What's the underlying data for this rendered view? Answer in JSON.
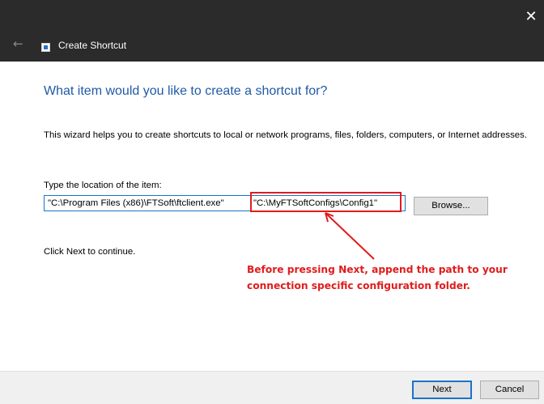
{
  "window": {
    "title": "Create Shortcut",
    "close_glyph": "✕",
    "back_glyph": "←",
    "back_icon": "back-arrow-icon",
    "app_icon": "shortcut-app-icon"
  },
  "wizard": {
    "heading": "What item would you like to create a shortcut for?",
    "description": "This wizard helps you to create shortcuts to local or network programs, files, folders, computers, or Internet addresses.",
    "location_label": "Type the location of the item:",
    "location_value_part1": "\"C:\\Program Files (x86)\\FTSoft\\ftclient.exe\"",
    "location_value_part2": "\"C:\\MyFTSoftConfigs\\Config1\"",
    "browse_label": "Browse...",
    "continue_text": "Click Next to continue."
  },
  "annotation": {
    "text": "Before pressing Next, append the path to your connection specific configuration folder.",
    "color": "#e01c1c"
  },
  "footer": {
    "next_label": "Next",
    "cancel_label": "Cancel"
  },
  "colors": {
    "titlebar": "#2b2b2b",
    "heading": "#1f5aa6",
    "accent": "#1a73c9"
  }
}
